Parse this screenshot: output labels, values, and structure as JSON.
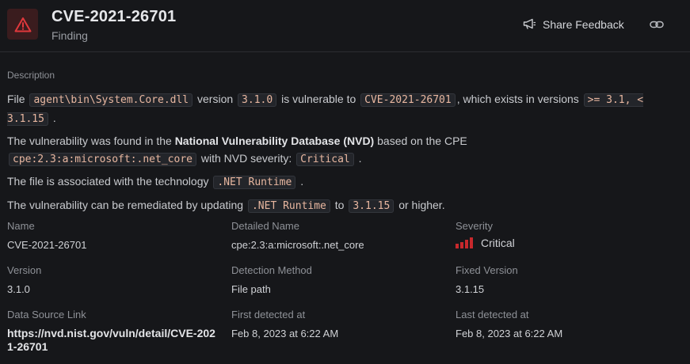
{
  "header": {
    "title": "CVE-2021-26701",
    "subtitle": "Finding",
    "share_label": "Share Feedback"
  },
  "description": {
    "section_label": "Description",
    "line1": {
      "pre": "File",
      "file": "agent\\bin\\System.Core.dll",
      "mid1": "version",
      "version": "3.1.0",
      "mid2": "is vulnerable to",
      "cve": "CVE-2021-26701",
      "mid3": ", which exists in versions",
      "range": ">= 3.1, < 3.1.15",
      "post": "."
    },
    "line2": {
      "pre": "The vulnerability was found in the",
      "db": "National Vulnerability Database (NVD)",
      "mid": "based on the CPE",
      "cpe": "cpe:2.3:a:microsoft:.net_core",
      "mid2": "with NVD severity:",
      "severity": "Critical",
      "post": "."
    },
    "line3": {
      "pre": "The file is associated with the technology",
      "tech": ".NET Runtime",
      "post": "."
    },
    "line4": {
      "pre": "The vulnerability can be remediated by updating",
      "tech": ".NET Runtime",
      "mid": "to",
      "version": "3.1.15",
      "post": "or higher."
    }
  },
  "details": {
    "name_label": "Name",
    "name_value": "CVE-2021-26701",
    "detailed_name_label": "Detailed Name",
    "detailed_name_value": "cpe:2.3:a:microsoft:.net_core",
    "severity_label": "Severity",
    "severity_value": "Critical",
    "version_label": "Version",
    "version_value": "3.1.0",
    "detection_label": "Detection Method",
    "detection_value": "File path",
    "fixed_label": "Fixed Version",
    "fixed_value": "3.1.15",
    "source_label": "Data Source Link",
    "source_value": "https://nvd.nist.gov/vuln/detail/CVE-2021-26701",
    "first_label": "First detected at",
    "first_value": "Feb 8, 2023 at 6:22 AM",
    "last_label": "Last detected at",
    "last_value": "Feb 8, 2023 at 6:22 AM"
  },
  "colors": {
    "background": "#16171a",
    "critical": "#c8282c",
    "code_text": "#e8b7a0"
  },
  "icons": {
    "alert": "warning-triangle-icon",
    "share": "megaphone-icon",
    "link": "chain-link-icon"
  }
}
